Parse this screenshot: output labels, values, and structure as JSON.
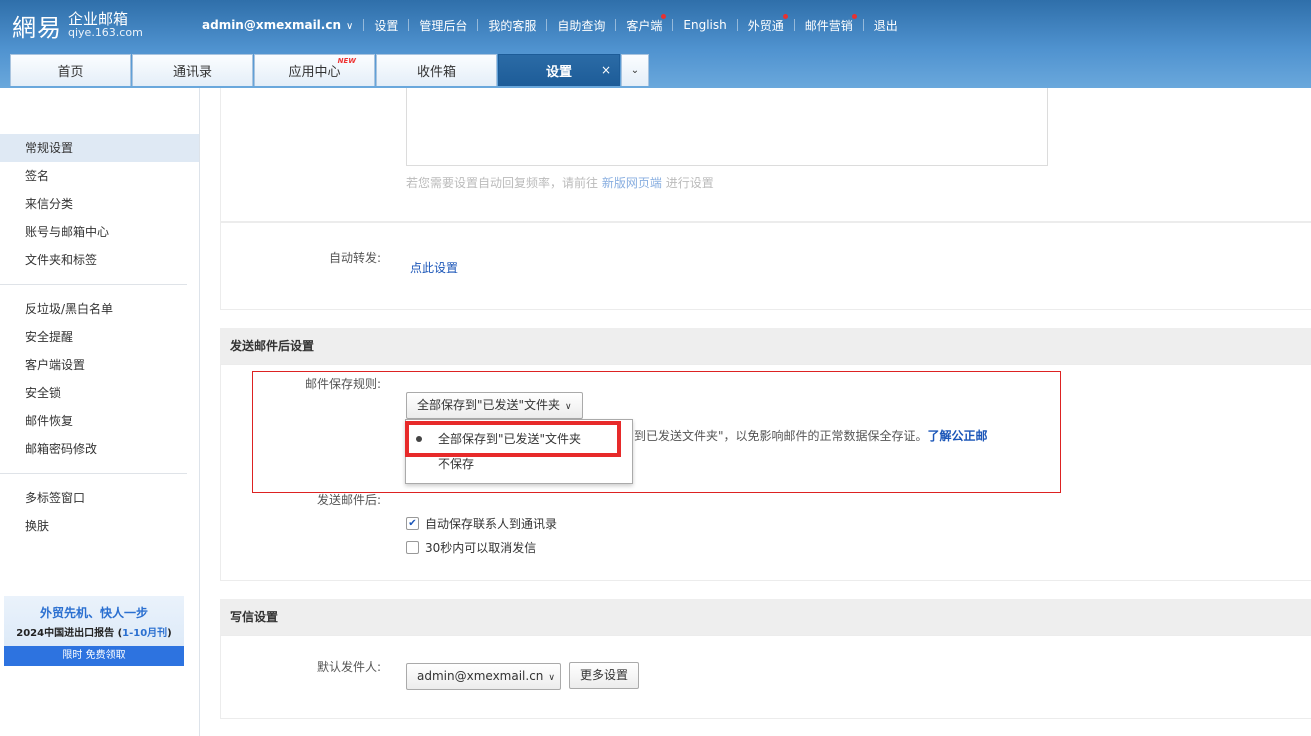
{
  "header": {
    "brand": "網易",
    "brand_sub1": "企业邮箱",
    "brand_sub2": "qiye.163.com",
    "account": "admin@xmexmail.cn",
    "nav": [
      {
        "label": "设置",
        "dot": false
      },
      {
        "label": "管理后台",
        "dot": false
      },
      {
        "label": "我的客服",
        "dot": false
      },
      {
        "label": "自助查询",
        "dot": false
      },
      {
        "label": "客户端",
        "dot": true
      },
      {
        "label": "English",
        "dot": false
      },
      {
        "label": "外贸通",
        "dot": true
      },
      {
        "label": "邮件营销",
        "dot": true
      },
      {
        "label": "退出",
        "dot": false
      }
    ]
  },
  "tabs": {
    "home": "首页",
    "contacts": "通讯录",
    "apps": "应用中心",
    "apps_badge": "NEW",
    "inbox": "收件箱",
    "settings": "设置",
    "close": "×",
    "more": "⌄"
  },
  "sidebar": {
    "items": [
      "常规设置",
      "签名",
      "来信分类",
      "账号与邮箱中心",
      "文件夹和标签",
      "反垃圾/黑白名单",
      "安全提醒",
      "客户端设置",
      "安全锁",
      "邮件恢复",
      "邮箱密码修改",
      "多标签窗口",
      "换肤"
    ],
    "promo": {
      "line1": "外贸先机、快人一步",
      "line2_pre": "2024中国进出口报告 (",
      "line2_hl": "1-10月刊",
      "line2_post": ")",
      "button": "限时 免费领取"
    }
  },
  "main": {
    "autoreply_hint_pre": "若您需要设置自动回复频率，请前往",
    "autoreply_hint_link": "新版网页端",
    "autoreply_hint_post": "进行设置",
    "forward_label": "自动转发:",
    "forward_link": "点此设置",
    "send_section_title": "发送邮件后设置",
    "save_rule_label": "邮件保存规则:",
    "save_rule_selected": "全部保存到\"已发送\"文件夹",
    "save_rule_options": [
      "全部保存到\"已发送\"文件夹",
      "不保存"
    ],
    "behind_text": "到已发送文件夹\"，以免影响邮件的正常数据保全存证。",
    "behind_link": "了解公正邮",
    "after_send_label": "发送邮件后:",
    "cb_save_contacts": "自动保存联系人到通讯录",
    "cb_save_contacts_checked": true,
    "cb_undo": "30秒内可以取消发信",
    "cb_undo_checked": false,
    "compose_section_title": "写信设置",
    "default_sender_label": "默认发件人:",
    "default_sender_value": "admin@xmexmail.cn",
    "more_settings": "更多设置"
  },
  "colors": {
    "header_blue": "#4f92cf",
    "active_tab": "#1d5c98",
    "highlight_red": "#e72a2a",
    "link_blue": "#1b56b8"
  }
}
